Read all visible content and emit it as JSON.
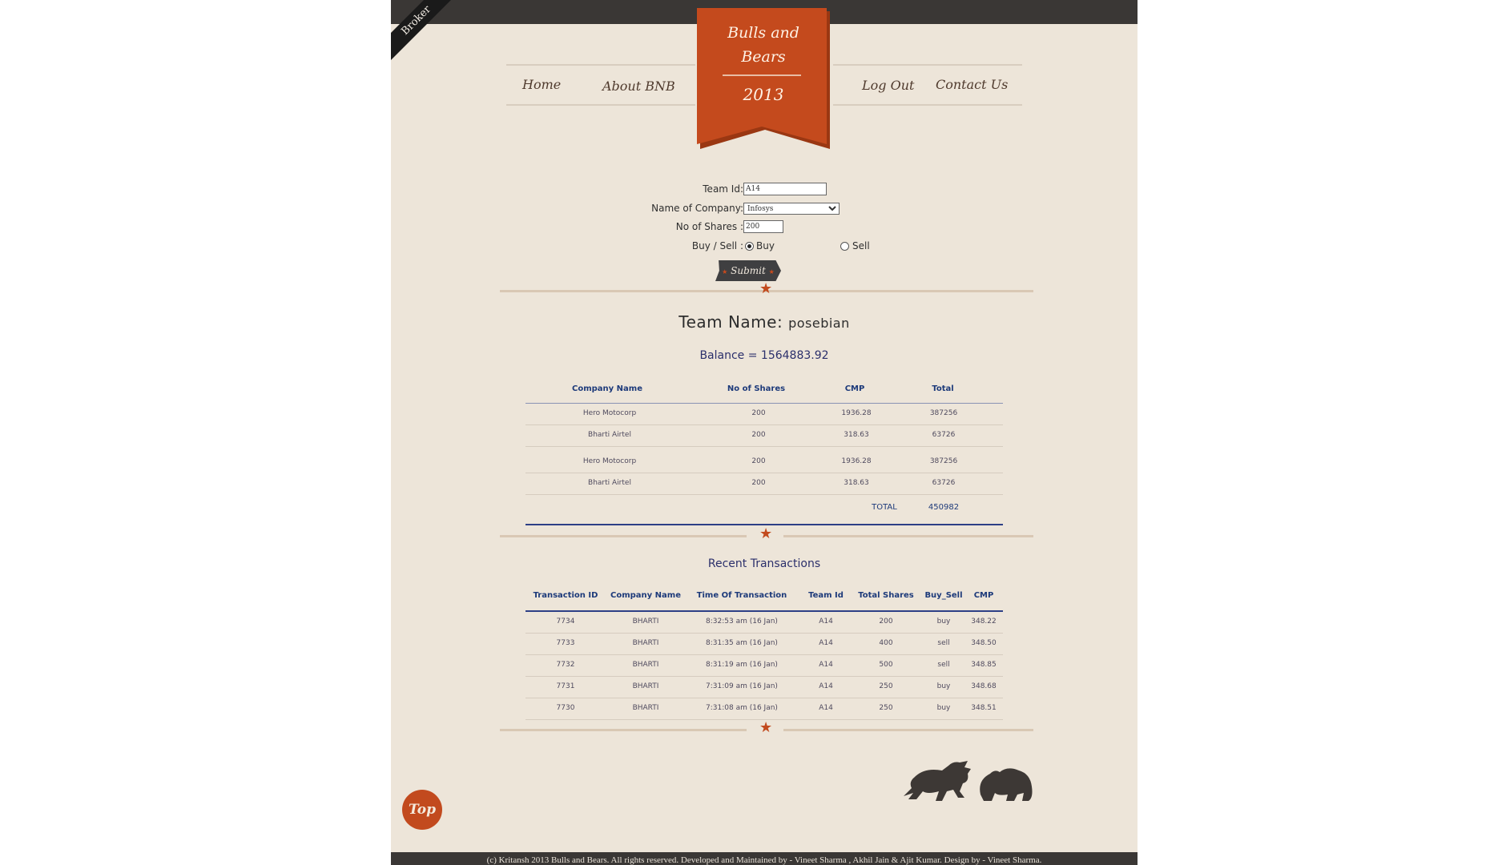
{
  "corner_label": "Broker",
  "nav": {
    "home": "Home",
    "about": "About BNB",
    "logout": "Log Out",
    "contact": "Contact Us"
  },
  "logo": {
    "line1": "Bulls and",
    "line2": "Bears",
    "year": "2013"
  },
  "form": {
    "team_id_label": "Team Id:",
    "team_id_value": "A14",
    "company_label": "Name of Company:",
    "company_selected": "Infosys",
    "shares_label": "No of Shares :",
    "shares_value": "200",
    "buy_sell_label": "Buy / Sell :",
    "buy_label": "Buy",
    "sell_label": "Sell",
    "selected_action": "Buy",
    "submit_label": "Submit"
  },
  "team": {
    "name_label": "Team Name:",
    "name_value": "posebian",
    "balance": "Balance = 1564883.92"
  },
  "holdings": {
    "headers": [
      "Company Name",
      "No of Shares",
      "CMP",
      "Total"
    ],
    "rows": [
      [
        "Hero Motocorp",
        "200",
        "1936.28",
        "387256"
      ],
      [
        "Bharti Airtel",
        "200",
        "318.63",
        "63726"
      ],
      [
        "Hero Motocorp",
        "200",
        "1936.28",
        "387256"
      ],
      [
        "Bharti Airtel",
        "200",
        "318.63",
        "63726"
      ]
    ],
    "total_label": "TOTAL",
    "total_value": "450982"
  },
  "transactions": {
    "title": "Recent Transactions",
    "headers": [
      "Transaction ID",
      "Company Name",
      "Time Of Transaction",
      "Team Id",
      "Total Shares",
      "Buy_Sell",
      "CMP"
    ],
    "rows": [
      [
        "7734",
        "BHARTI",
        "8:32:53 am (16 Jan)",
        "A14",
        "200",
        "buy",
        "348.22"
      ],
      [
        "7733",
        "BHARTI",
        "8:31:35 am (16 Jan)",
        "A14",
        "400",
        "sell",
        "348.50"
      ],
      [
        "7732",
        "BHARTI",
        "8:31:19 am (16 Jan)",
        "A14",
        "500",
        "sell",
        "348.85"
      ],
      [
        "7731",
        "BHARTI",
        "7:31:09 am (16 Jan)",
        "A14",
        "250",
        "buy",
        "348.68"
      ],
      [
        "7730",
        "BHARTI",
        "7:31:08 am (16 Jan)",
        "A14",
        "250",
        "buy",
        "348.51"
      ]
    ]
  },
  "top_button": "Top",
  "footer": "(c) Kritansh 2013 Bulls and Bears. All rights reserved. Developed and Maintained by - Vineet Sharma , Akhil Jain & Ajit Kumar. Design by - Vineet Sharma.",
  "colors": {
    "background": "#ede5d9",
    "accent": "#c24a1e",
    "dark": "#3a3735",
    "table_header": "#1d3a7a"
  }
}
